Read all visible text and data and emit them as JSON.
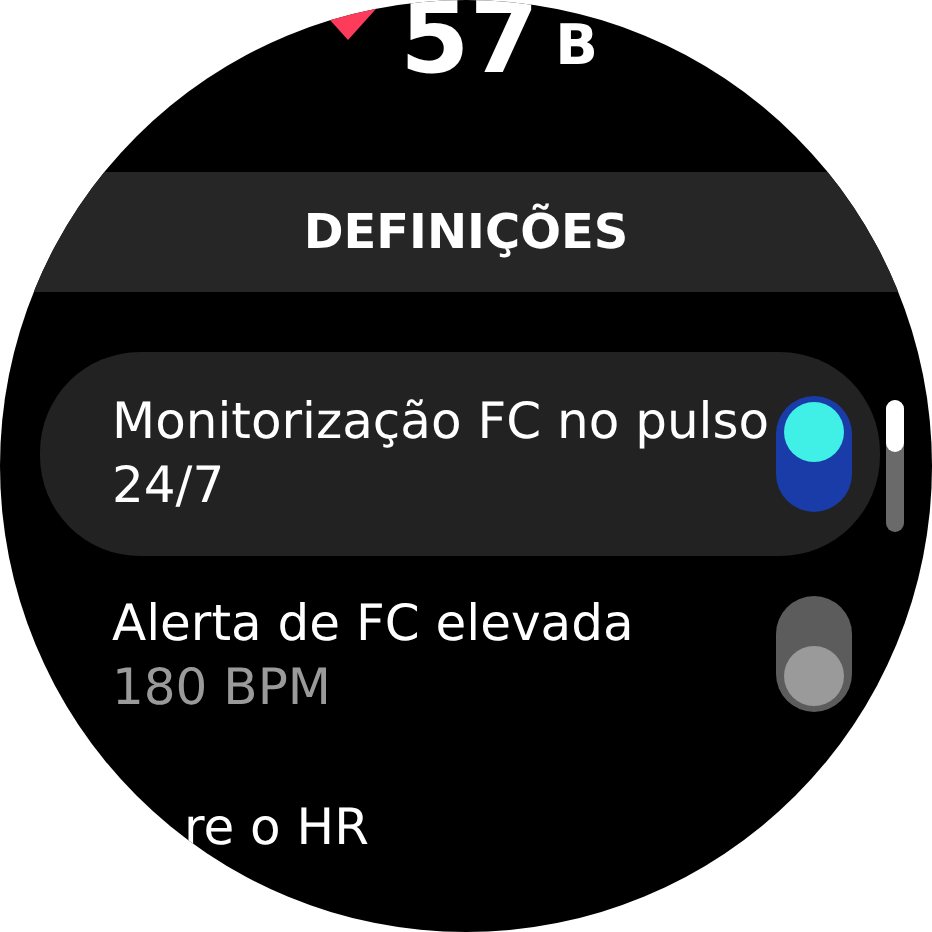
{
  "heart_rate": {
    "value": "57",
    "unit": "B"
  },
  "header": {
    "title": "DEFINIÇÕES"
  },
  "settings": [
    {
      "kind": "toggle",
      "label": "Monitorização FC no pulso 24/7",
      "on": true,
      "selected": true
    },
    {
      "kind": "toggle",
      "label": "Alerta de FC elevada",
      "sublabel": "180 BPM",
      "on": false,
      "selected": false
    },
    {
      "kind": "link",
      "label": "re o HR",
      "selected": false
    }
  ]
}
